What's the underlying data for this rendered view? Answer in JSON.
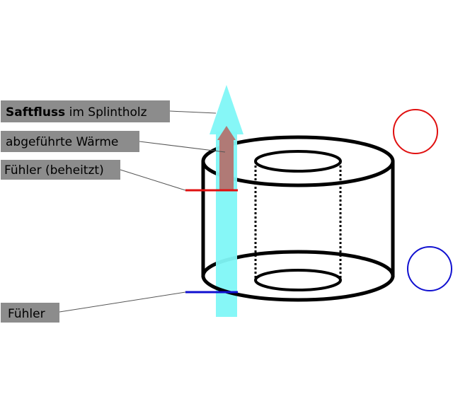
{
  "labels": {
    "sapflow_bold": "Saftfluss",
    "sapflow_rest": " im Splintholz",
    "heat": "abgeführte Wärme",
    "sensor_heated": "Fühler (beheitzt)",
    "sensor": "Fühler"
  },
  "colors": {
    "label_bg": "#8c8c8c",
    "sapflow_arrow": "#7ff7f7",
    "heat_arrow": "#b07a76",
    "heated_sensor": "#e01010",
    "reference_sensor": "#1010d0"
  }
}
